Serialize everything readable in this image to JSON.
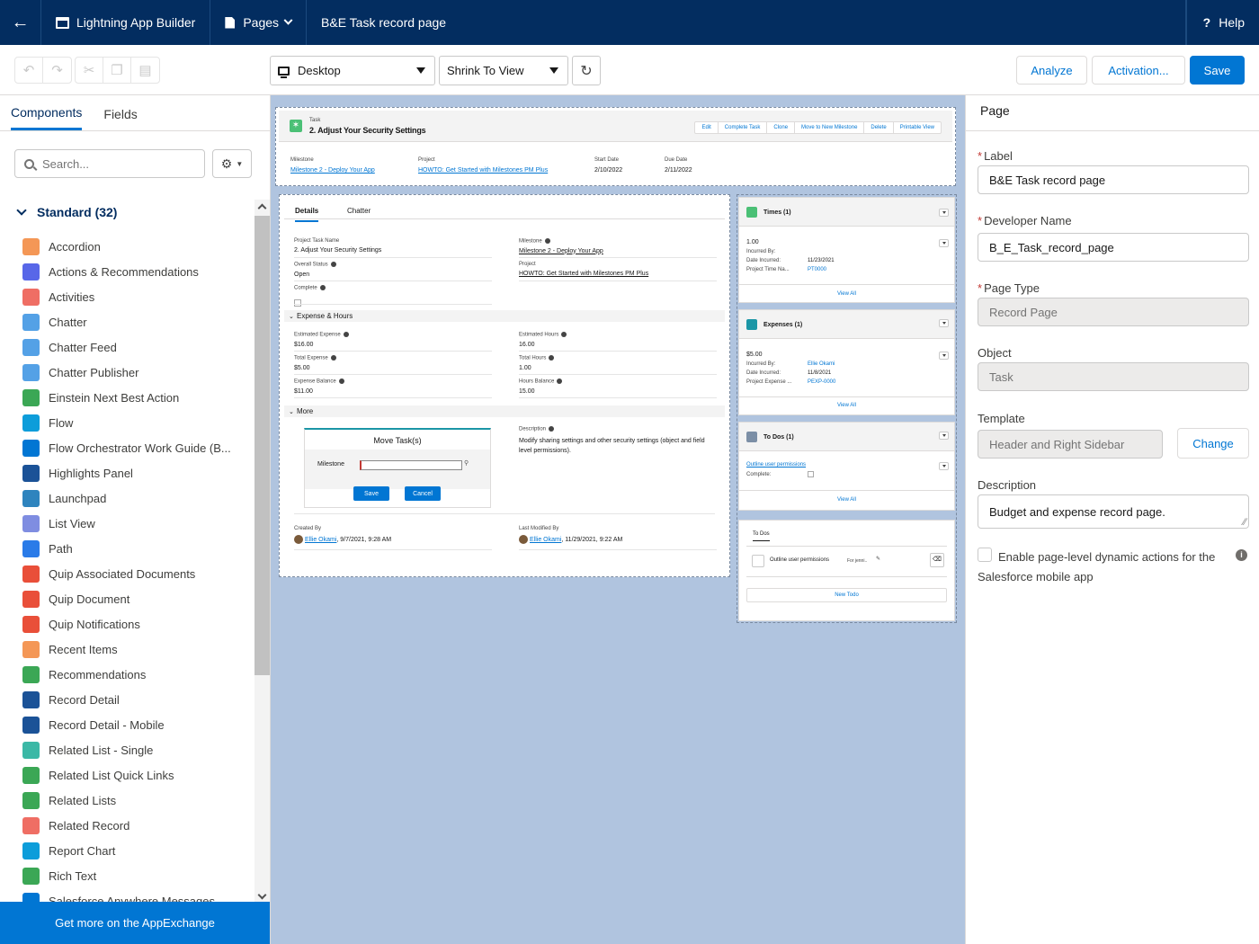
{
  "topbar": {
    "app_title": "Lightning App Builder",
    "pages_label": "Pages",
    "page_name": "B&E Task record page",
    "help_label": "Help"
  },
  "toolbar": {
    "device": "Desktop",
    "view": "Shrink To View",
    "analyze": "Analyze",
    "activation": "Activation...",
    "save": "Save"
  },
  "left": {
    "tab_components": "Components",
    "tab_fields": "Fields",
    "search_placeholder": "Search...",
    "section": "Standard (32)",
    "appexchange": "Get more on the AppExchange",
    "components": [
      {
        "label": "Accordion",
        "color": "#f49756",
        "icon": "accordion-icon"
      },
      {
        "label": "Actions & Recommendations",
        "color": "#5867e8",
        "icon": "actions-icon"
      },
      {
        "label": "Activities",
        "color": "#ef6e64",
        "icon": "activities-icon"
      },
      {
        "label": "Chatter",
        "color": "#54a1e6",
        "icon": "chatter-icon"
      },
      {
        "label": "Chatter Feed",
        "color": "#54a1e6",
        "icon": "chatter-feed-icon"
      },
      {
        "label": "Chatter Publisher",
        "color": "#54a1e6",
        "icon": "chatter-publisher-icon"
      },
      {
        "label": "Einstein Next Best Action",
        "color": "#3ba755",
        "icon": "einstein-icon"
      },
      {
        "label": "Flow",
        "color": "#0d9dda",
        "icon": "flow-icon"
      },
      {
        "label": "Flow Orchestrator Work Guide (B...",
        "color": "#0176d3",
        "icon": "flow-orchestrator-icon"
      },
      {
        "label": "Highlights Panel",
        "color": "#1b5297",
        "icon": "highlights-icon"
      },
      {
        "label": "Launchpad",
        "color": "#2e84be",
        "icon": "launchpad-icon"
      },
      {
        "label": "List View",
        "color": "#7f8de1",
        "icon": "list-view-icon"
      },
      {
        "label": "Path",
        "color": "#2a7be8",
        "icon": "path-icon"
      },
      {
        "label": "Quip Associated Documents",
        "color": "#e94f39",
        "icon": "quip-icon"
      },
      {
        "label": "Quip Document",
        "color": "#e94f39",
        "icon": "quip-doc-icon"
      },
      {
        "label": "Quip Notifications",
        "color": "#e94f39",
        "icon": "quip-notif-icon"
      },
      {
        "label": "Recent Items",
        "color": "#f49756",
        "icon": "recent-icon"
      },
      {
        "label": "Recommendations",
        "color": "#3ba755",
        "icon": "recommendations-icon"
      },
      {
        "label": "Record Detail",
        "color": "#1b5297",
        "icon": "record-detail-icon"
      },
      {
        "label": "Record Detail - Mobile",
        "color": "#1b5297",
        "icon": "record-detail-mobile-icon"
      },
      {
        "label": "Related List - Single",
        "color": "#3bb8a6",
        "icon": "related-list-single-icon"
      },
      {
        "label": "Related List Quick Links",
        "color": "#3ba755",
        "icon": "related-quick-links-icon"
      },
      {
        "label": "Related Lists",
        "color": "#3ba755",
        "icon": "related-lists-icon"
      },
      {
        "label": "Related Record",
        "color": "#ef6e64",
        "icon": "related-record-icon"
      },
      {
        "label": "Report Chart",
        "color": "#0d9dda",
        "icon": "report-chart-icon"
      },
      {
        "label": "Rich Text",
        "color": "#3ba755",
        "icon": "rich-text-icon"
      },
      {
        "label": "Salesforce Anywhere Messages",
        "color": "#0176d3",
        "icon": "anywhere-icon"
      }
    ]
  },
  "record": {
    "object": "Task",
    "title": "2. Adjust Your Security Settings",
    "actions": [
      "Edit",
      "Complete Task",
      "Clone",
      "Move to New Milestone",
      "Delete",
      "Printable View"
    ],
    "highlights": [
      {
        "label": "Milestone",
        "value": "Milestone 2 - Deploy Your App",
        "link": true
      },
      {
        "label": "Project",
        "value": "HOWTO: Get Started with Milestones PM Plus",
        "link": true
      },
      {
        "label": "Start Date",
        "value": "2/10/2022",
        "link": false
      },
      {
        "label": "Due Date",
        "value": "2/11/2022",
        "link": false
      }
    ],
    "tabs": [
      "Details",
      "Chatter"
    ],
    "fields": {
      "project_task_name_l": "Project Task Name",
      "project_task_name": "2. Adjust Your Security Settings",
      "milestone_l": "Milestone",
      "milestone": "Milestone 2 - Deploy Your App",
      "overall_status_l": "Overall Status",
      "overall_status": "Open",
      "project_l": "Project",
      "project": "HOWTO: Get Started with Milestones PM Plus",
      "complete_l": "Complete"
    },
    "section_expense": "Expense & Hours",
    "expense": {
      "est_exp_l": "Estimated Expense",
      "est_exp": "$16.00",
      "est_hrs_l": "Estimated Hours",
      "est_hrs": "16.00",
      "tot_exp_l": "Total Expense",
      "tot_exp": "$5.00",
      "tot_hrs_l": "Total Hours",
      "tot_hrs": "1.00",
      "exp_bal_l": "Expense Balance",
      "exp_bal": "$11.00",
      "hrs_bal_l": "Hours Balance",
      "hrs_bal": "15.00"
    },
    "section_more": "More",
    "move": {
      "title": "Move Task(s)",
      "milestone_l": "Milestone",
      "save": "Save",
      "cancel": "Cancel"
    },
    "description_l": "Description",
    "description": "Modify sharing settings and other security settings (object and field level permissions).",
    "created_l": "Created By",
    "created_user": "Ellie Okami",
    "created_date": ", 9/7/2021, 9:28 AM",
    "modified_l": "Last Modified By",
    "modified_user": "Ellie Okami",
    "modified_date": ", 11/29/2021, 9:22 AM"
  },
  "sidebar": {
    "times_title": "Times (1)",
    "times_value": "1.00",
    "times_incurred_by_l": "Incurred By:",
    "times_date_l": "Date Incurred:",
    "times_date": "11/23/2021",
    "times_proj_l": "Project Time Na...",
    "times_proj": "PT0000",
    "view_all": "View All",
    "exp_title": "Expenses (1)",
    "exp_value": "$5.00",
    "exp_incurred_by_l": "Incurred By:",
    "exp_incurred_by": "Ellie Okami",
    "exp_date_l": "Date Incurred:",
    "exp_date": "11/8/2021",
    "exp_proj_l": "Project Expense ...",
    "exp_proj": "PEXP-0000",
    "todo_title": "To Dos (1)",
    "todo_link": "Outline user permissions",
    "todo_complete_l": "Complete:",
    "todos_tab": "To Dos",
    "todo_item": "Outline user permissions",
    "todo_for": "For jenni..",
    "new_todo": "New Todo"
  },
  "right": {
    "header": "Page",
    "label_l": "Label",
    "label": "B&E Task record page",
    "dev_l": "Developer Name",
    "dev": "B_E_Task_record_page",
    "type_l": "Page Type",
    "type": "Record Page",
    "object_l": "Object",
    "object": "Task",
    "template_l": "Template",
    "template": "Header and Right Sidebar",
    "change": "Change",
    "desc_l": "Description",
    "desc": "Budget and expense record page.",
    "dyn_actions": "Enable page-level dynamic actions for the Salesforce mobile app"
  }
}
